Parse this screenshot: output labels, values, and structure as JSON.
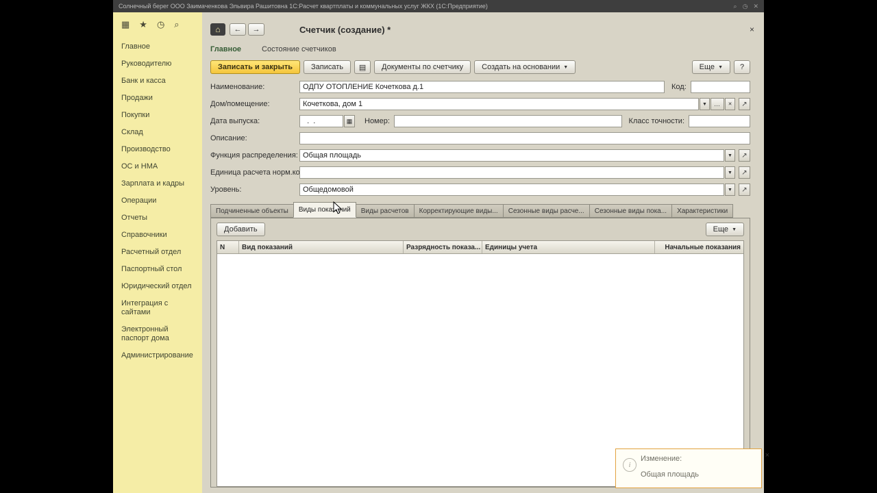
{
  "titlebar": {
    "text": "Солнечный берег ООО   Заимаченкова Эльвира Рашитовна   1С:Расчет квартплаты и коммунальных услуг ЖКХ (1С:Предприятие)"
  },
  "sidebar": {
    "items": [
      "Главное",
      "Руководителю",
      "Банк и касса",
      "Продажи",
      "Покупки",
      "Склад",
      "Производство",
      "ОС и НМА",
      "Зарплата и кадры",
      "Операции",
      "Отчеты",
      "Справочники",
      "Расчетный отдел",
      "Паспортный стол",
      "Юридический отдел",
      "Интеграция с сайтами",
      "Электронный паспорт дома",
      "Администрирование"
    ]
  },
  "nav": {
    "title": "Счетчик (создание) *",
    "close": "×"
  },
  "page_tabs": {
    "main": "Главное",
    "states": "Состояние счетчиков"
  },
  "toolbar": {
    "save_close": "Записать и закрыть",
    "save": "Записать",
    "documents": "Документы по счетчику",
    "create_based": "Создать на основании",
    "more": "Еще",
    "help": "?"
  },
  "form": {
    "name_label": "Наименование:",
    "name_value": "ОДПУ ОТОПЛЕНИЕ Кочеткова д.1",
    "code_label": "Код:",
    "code_value": "",
    "house_label": "Дом/помещение:",
    "house_value": "Кочеткова, дом 1",
    "date_label": "Дата выпуска:",
    "date_value": "  .  .",
    "number_label": "Номер:",
    "number_value": "",
    "accuracy_label": "Класс точности:",
    "accuracy_value": "",
    "desc_label": "Описание:",
    "desc_value": "",
    "func_label": "Функция распределения:",
    "func_value": "Общая площадь",
    "unit_label": "Единица расчета норм.кол.:",
    "unit_value": "",
    "level_label": "Уровень:",
    "level_value": "Общедомовой"
  },
  "detail_tabs": [
    "Подчиненные объекты",
    "Виды показаний",
    "Виды расчетов",
    "Корректирующие виды...",
    "Сезонные виды расче...",
    "Сезонные виды пока...",
    "Характеристики"
  ],
  "grid": {
    "add": "Добавить",
    "more": "Еще",
    "headers": [
      "N",
      "Вид показаний",
      "Разрядность показа...",
      "Единицы учета",
      "Начальные показания"
    ]
  },
  "notification": {
    "title": "Изменение:",
    "text": "Общая площадь",
    "close": "×"
  }
}
